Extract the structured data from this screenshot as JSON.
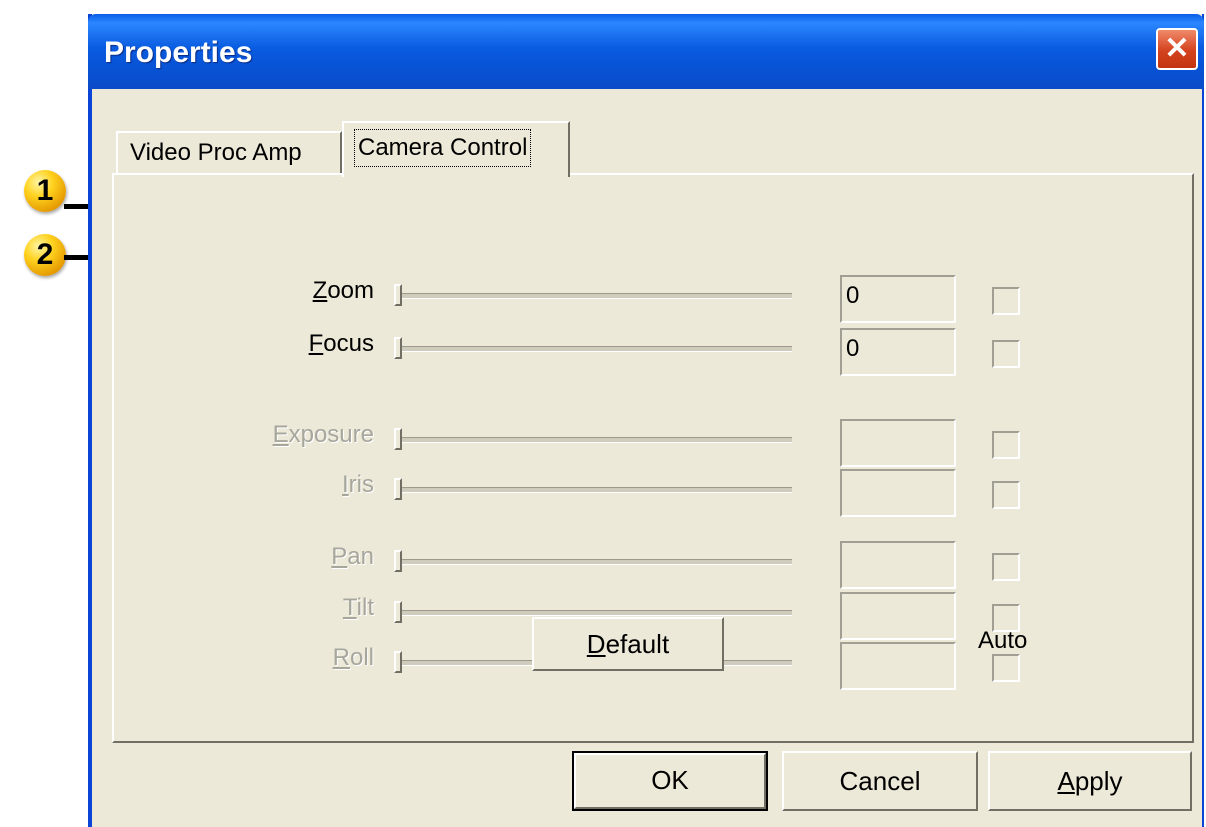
{
  "callouts": [
    "1",
    "2"
  ],
  "window": {
    "title": "Properties",
    "close_glyph": "✕"
  },
  "tabs": [
    {
      "label": "Video Proc Amp",
      "active": false
    },
    {
      "label": "Camera Control",
      "active": true
    }
  ],
  "controls": [
    {
      "mnemonic": "Z",
      "rest": "oom",
      "value": "0",
      "enabled": true
    },
    {
      "mnemonic": "F",
      "rest": "ocus",
      "value": "0",
      "enabled": true
    },
    {
      "mnemonic": "E",
      "rest": "xposure",
      "value": "",
      "enabled": false
    },
    {
      "mnemonic": "I",
      "rest": "ris",
      "value": "",
      "enabled": false
    },
    {
      "mnemonic": "P",
      "rest": "an",
      "value": "",
      "enabled": false
    },
    {
      "mnemonic": "T",
      "rest": "ilt",
      "value": "",
      "enabled": false
    },
    {
      "mnemonic": "R",
      "rest": "oll",
      "value": "",
      "enabled": false
    }
  ],
  "default_button": {
    "mnemonic": "D",
    "rest": "efault"
  },
  "auto_label": "Auto",
  "buttons": {
    "ok": "OK",
    "cancel": "Cancel",
    "apply": {
      "mnemonic": "A",
      "rest": "pply"
    }
  },
  "colors": {
    "titlebar": "#0a5ce0",
    "dialog_bg": "#ece9d8",
    "close_button": "#d4421e",
    "disabled_text": "#a7a69c",
    "callout": "#ffd21f"
  }
}
